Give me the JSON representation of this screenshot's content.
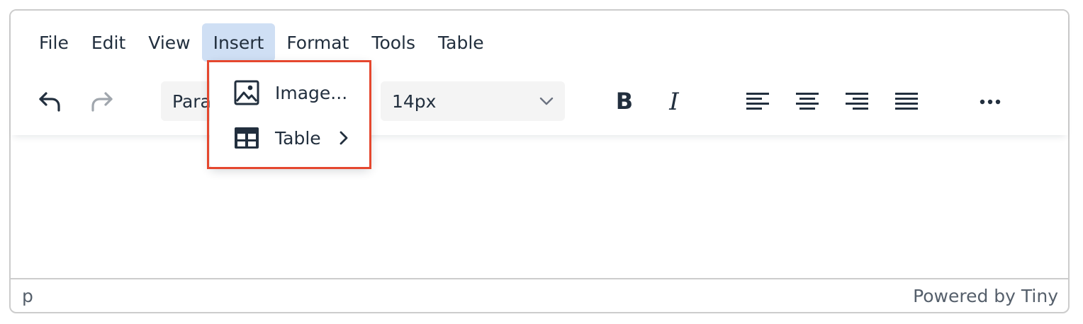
{
  "menubar": {
    "items": [
      {
        "label": "File"
      },
      {
        "label": "Edit"
      },
      {
        "label": "View"
      },
      {
        "label": "Insert",
        "active": true
      },
      {
        "label": "Format"
      },
      {
        "label": "Tools"
      },
      {
        "label": "Table"
      }
    ]
  },
  "toolbar": {
    "undo_icon": "undo-icon",
    "redo_icon": "redo-icon",
    "block_format": {
      "value": "Paragraph",
      "visible_text": "Para"
    },
    "font_size": {
      "value": "14px"
    },
    "bold_icon": "bold-icon",
    "italic_icon": "italic-icon",
    "align_left_icon": "align-left-icon",
    "align_center_icon": "align-center-icon",
    "align_right_icon": "align-right-icon",
    "align_justify_icon": "align-justify-icon",
    "more_icon": "more-icon"
  },
  "insert_menu": {
    "items": [
      {
        "label": "Image...",
        "icon": "image-icon"
      },
      {
        "label": "Table",
        "icon": "table-icon",
        "submenu": true
      }
    ]
  },
  "statusbar": {
    "path": "p",
    "branding": "Powered by Tiny"
  },
  "colors": {
    "text": "#222f3e",
    "active_menu_bg": "#cfdff4",
    "highlight_border": "#e5472e",
    "border": "#cccccc",
    "select_bg": "#f4f4f4"
  }
}
